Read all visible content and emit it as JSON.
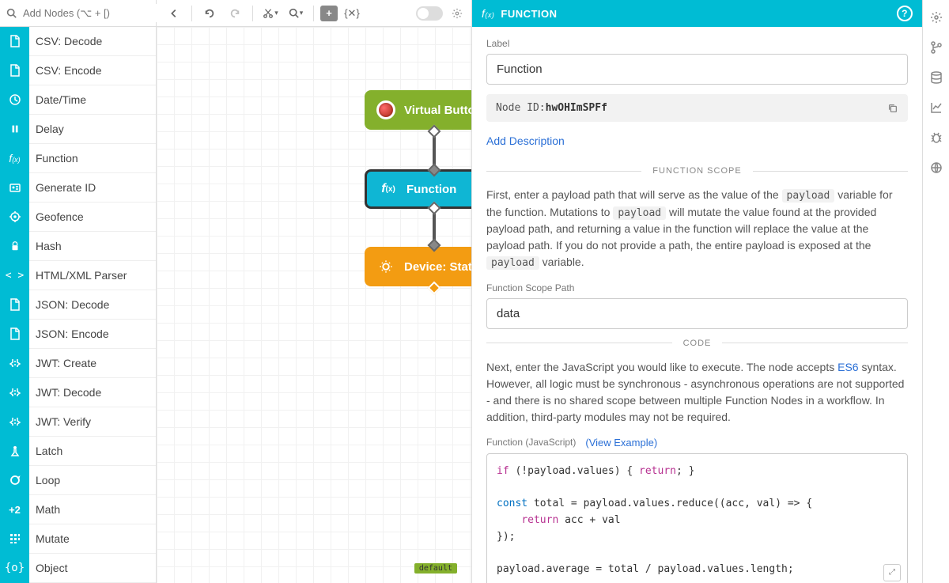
{
  "nodeSearch": {
    "placeholder": "Add Nodes (⌥ + [)"
  },
  "nodes": [
    {
      "label": "CSV: Decode",
      "icon": "file"
    },
    {
      "label": "CSV: Encode",
      "icon": "file"
    },
    {
      "label": "Date/Time",
      "icon": "clock"
    },
    {
      "label": "Delay",
      "icon": "pause"
    },
    {
      "label": "Function",
      "icon": "fx"
    },
    {
      "label": "Generate ID",
      "icon": "idcard"
    },
    {
      "label": "Geofence",
      "icon": "target"
    },
    {
      "label": "Hash",
      "icon": "lock"
    },
    {
      "label": "HTML/XML Parser",
      "icon": "code"
    },
    {
      "label": "JSON: Decode",
      "icon": "file"
    },
    {
      "label": "JSON: Encode",
      "icon": "file"
    },
    {
      "label": "JWT: Create",
      "icon": "jwt"
    },
    {
      "label": "JWT: Decode",
      "icon": "jwt"
    },
    {
      "label": "JWT: Verify",
      "icon": "jwt"
    },
    {
      "label": "Latch",
      "icon": "latch"
    },
    {
      "label": "Loop",
      "icon": "loop"
    },
    {
      "label": "Math",
      "icon": "math"
    },
    {
      "label": "Mutate",
      "icon": "mutate"
    },
    {
      "label": "Object",
      "icon": "object"
    }
  ],
  "canvas": {
    "virtualButton": "Virtual Button",
    "function": "Function",
    "deviceState": "Device: State",
    "defaultTag": "default"
  },
  "inspector": {
    "headerTitle": "FUNCTION",
    "labelField": "Label",
    "labelValue": "Function",
    "nodeIdLabel": "Node ID: ",
    "nodeId": "hwOHImSPFf",
    "addDescription": "Add Description",
    "scopeSection": "FUNCTION SCOPE",
    "scopeDesc1": "First, enter a payload path that will serve as the value of the ",
    "scopeCode1": "payload",
    "scopeDesc2": " variable for the function. Mutations to ",
    "scopeCode2": "payload",
    "scopeDesc3": " will mutate the value found at the provided payload path, and returning a value in the function will replace the value at the payload path. If you do not provide a path, the entire payload is exposed at the ",
    "scopeCode3": "payload",
    "scopeDesc4": " variable.",
    "scopePathLabel": "Function Scope Path",
    "scopePathValue": "data",
    "codeSection": "CODE",
    "codeDesc1": "Next, enter the JavaScript you would like to execute. The node accepts ",
    "codeLink": "ES6",
    "codeDesc2": " syntax. However, all logic must be synchronous - asynchronous operations are not supported - and there is no shared scope between multiple Function Nodes in a workflow. In addition, third-party modules may not be required.",
    "codeLabel": "Function (JavaScript)",
    "viewExample": "(View Example)",
    "code": {
      "l1a": "if",
      "l1b": " (!payload.values) { ",
      "l1c": "return",
      "l1d": "; }",
      "l2a": "const",
      "l2b": " total = payload.values.reduce((acc, val) => {",
      "l3a": "    ",
      "l3b": "return",
      "l3c": " acc + val",
      "l4": "});",
      "l5": "payload.average = total / payload.values.length;"
    }
  },
  "iconLabels": {
    "math": "+2"
  }
}
